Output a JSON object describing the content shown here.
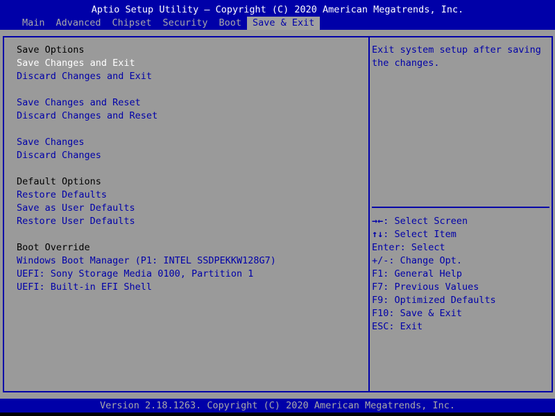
{
  "header": {
    "title": "Aptio Setup Utility – Copyright (C) 2020 American Megatrends, Inc."
  },
  "tabs": [
    {
      "label": "Main",
      "active": false
    },
    {
      "label": "Advanced",
      "active": false
    },
    {
      "label": "Chipset",
      "active": false
    },
    {
      "label": "Security",
      "active": false
    },
    {
      "label": "Boot",
      "active": false
    },
    {
      "label": "Save & Exit",
      "active": true
    }
  ],
  "main": {
    "save_options_header": "Save Options",
    "save_changes_and_exit": "Save Changes and Exit",
    "discard_changes_and_exit": "Discard Changes and Exit",
    "save_changes_and_reset": "Save Changes and Reset",
    "discard_changes_and_reset": "Discard Changes and Reset",
    "save_changes": "Save Changes",
    "discard_changes": "Discard Changes",
    "default_options_header": "Default Options",
    "restore_defaults": "Restore Defaults",
    "save_as_user_defaults": "Save as User Defaults",
    "restore_user_defaults": "Restore User Defaults",
    "boot_override_header": "Boot Override",
    "boot_windows": "Windows Boot Manager (P1: INTEL SSDPEKKW128G7)",
    "boot_sony": "UEFI: Sony Storage Media 0100, Partition 1",
    "boot_efi_shell": "UEFI: Built-in EFI Shell"
  },
  "help": {
    "description": "Exit system setup after saving the changes.",
    "keys": [
      {
        "key": "→←",
        "desc": ": Select Screen"
      },
      {
        "key": "↑↓",
        "desc": ": Select Item"
      },
      {
        "key": "",
        "desc": "Enter: Select"
      },
      {
        "key": "",
        "desc": "+/-: Change Opt."
      },
      {
        "key": "",
        "desc": "F1: General Help"
      },
      {
        "key": "",
        "desc": "F7: Previous Values"
      },
      {
        "key": "",
        "desc": "F9: Optimized Defaults"
      },
      {
        "key": "",
        "desc": "F10: Save & Exit"
      },
      {
        "key": "",
        "desc": "ESC: Exit"
      }
    ]
  },
  "footer": {
    "text": "Version 2.18.1263. Copyright (C) 2020 American Megatrends, Inc."
  }
}
